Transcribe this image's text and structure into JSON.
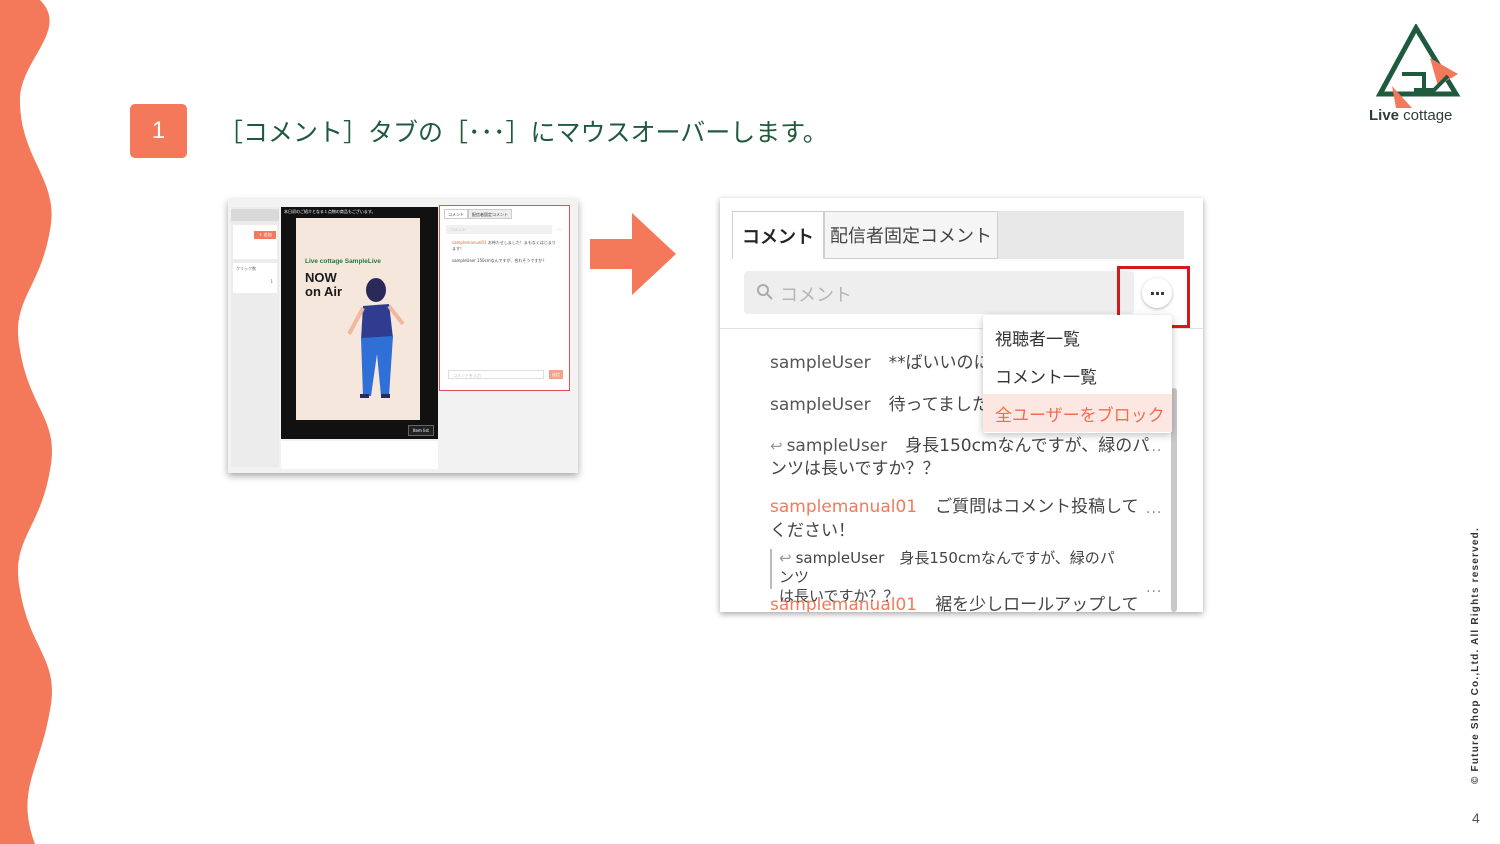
{
  "step": {
    "number": "1",
    "title": "［コメント］タブの［･･･］にマウスオーバーします。"
  },
  "brand": {
    "logo_bold": "Live",
    "logo_rest": " cottage",
    "accent": "#f4795b",
    "green": "#1f5a3f"
  },
  "footer": {
    "copyright": "© Future Shop Co.,Ltd. All Rights reserved.",
    "page": "4"
  },
  "small_screenshot": {
    "notice": "本日初のご紹介となる１点物の商品もございます。",
    "add_label": "＋ 追加",
    "click_label": "クリック数",
    "click_count": "1",
    "live_name": "Live cottage SampleLive",
    "now_on_air_1": "NOW",
    "now_on_air_2": "on Air",
    "item_list": "Item list",
    "tab_comment": "コメント",
    "tab_pinned": "配信者固定コメント",
    "search_placeholder": "コメント",
    "msg1_user": "samplemanual01",
    "msg1_text": "お待たせしました！まもなくはじまります！",
    "msg2_user": "sampleUser",
    "msg2_text": "150cmなんですが、合わそうですか？",
    "input_placeholder": "コメントを入力",
    "send": "送信"
  },
  "big_screenshot": {
    "tab_comment": "コメント",
    "tab_pinned": "配信者固定コメント",
    "search_placeholder": "コメント",
    "menu_button": "···",
    "comments": [
      {
        "user": "sampleUser",
        "text": "**ばいいのに"
      },
      {
        "user": "sampleUser",
        "text": "待ってました"
      },
      {
        "user": "sampleUser",
        "text": "身長150cmなんですが、緑のパ",
        "text2": "ンツは長いですか？？"
      },
      {
        "user": "samplemanual01",
        "text": "ご質問はコメント投稿して",
        "text2": "ください！"
      },
      {
        "user": "samplemanual01",
        "text": "裾を少しロールアップして"
      }
    ],
    "quote_user": "sampleUser",
    "quote_text": "身長150cmなんですが、緑のパンツ",
    "quote_text2": "は長いですか？？",
    "dropdown": [
      "視聴者一覧",
      "コメント一覧",
      "全ユーザーをブロック"
    ]
  }
}
